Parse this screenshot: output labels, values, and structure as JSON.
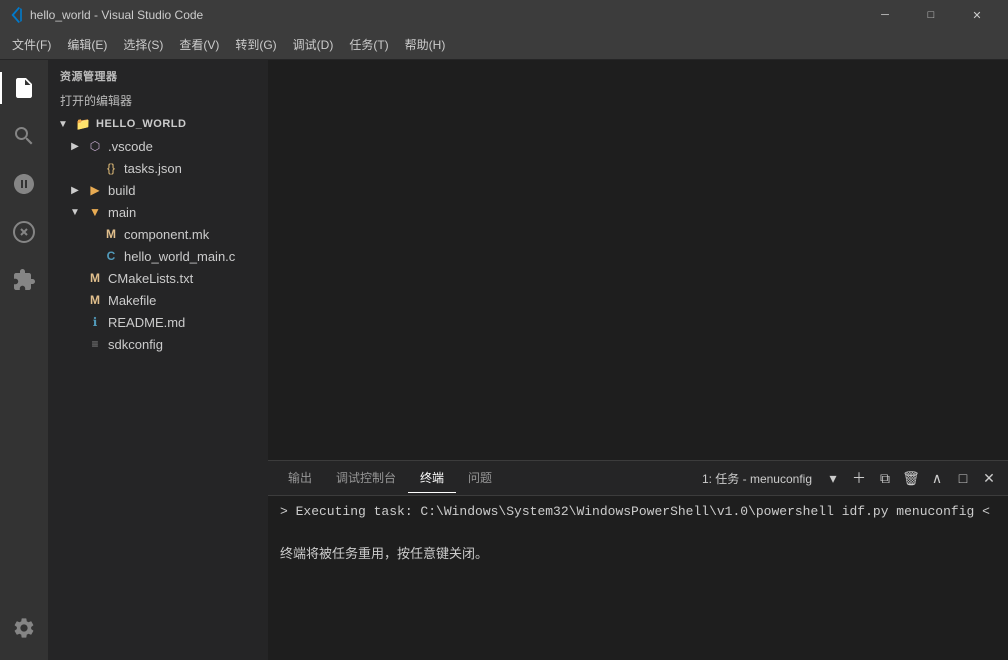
{
  "titlebar": {
    "icon": "⬡",
    "title": "hello_world - Visual Studio Code",
    "minimize": "─",
    "maximize": "□",
    "close": "✕"
  },
  "menubar": {
    "items": [
      "文件(F)",
      "编辑(E)",
      "选择(S)",
      "查看(V)",
      "转到(G)",
      "调试(D)",
      "任务(T)",
      "帮助(H)"
    ]
  },
  "sidebar": {
    "section_manager": "资源管理器",
    "section_open_editors": "打开的编辑器",
    "project_name": "HELLO_WORLD",
    "files": [
      {
        "id": "vscode-folder",
        "indent": 12,
        "arrow": "▶",
        "type": "folder",
        "name": ".vscode",
        "color": "icon-folder"
      },
      {
        "id": "tasks-json",
        "indent": 26,
        "arrow": "",
        "type": "json",
        "name": "tasks.json",
        "color": "icon-yellow"
      },
      {
        "id": "build-folder",
        "indent": 12,
        "arrow": "▶",
        "type": "folder",
        "name": "build",
        "color": "icon-folder"
      },
      {
        "id": "main-folder",
        "indent": 12,
        "arrow": "▼",
        "type": "folder",
        "name": "main",
        "color": "icon-folder"
      },
      {
        "id": "component-mk",
        "indent": 26,
        "arrow": "",
        "type": "m",
        "name": "component.mk",
        "color": "icon-m-modified"
      },
      {
        "id": "hello-world-main-c",
        "indent": 26,
        "arrow": "",
        "type": "c",
        "name": "hello_world_main.c",
        "color": "icon-c-file"
      },
      {
        "id": "cmakelists",
        "indent": 12,
        "arrow": "",
        "type": "m",
        "name": "CMakeLists.txt",
        "color": "icon-m-modified"
      },
      {
        "id": "makefile",
        "indent": 12,
        "arrow": "",
        "type": "m",
        "name": "Makefile",
        "color": "icon-m-modified"
      },
      {
        "id": "readme",
        "indent": 12,
        "arrow": "",
        "type": "info",
        "name": "README.md",
        "color": "icon-info"
      },
      {
        "id": "sdkconfig",
        "indent": 12,
        "arrow": "",
        "type": "lines",
        "name": "sdkconfig",
        "color": ""
      }
    ]
  },
  "panel": {
    "tabs": [
      "输出",
      "调试控制台",
      "终端",
      "问题"
    ],
    "active_tab": "终端",
    "task_label": "1: 任务 - menuconfig",
    "terminal_cmd": "> Executing task: C:\\Windows\\System32\\WindowsPowerShell\\v1.0\\powershell idf.py menuconfig <",
    "terminal_msg": "终端将被任务重用，按任意键关闭。"
  },
  "activity_bar": {
    "icons": [
      "files",
      "search",
      "git",
      "debug",
      "extensions",
      "settings"
    ]
  }
}
